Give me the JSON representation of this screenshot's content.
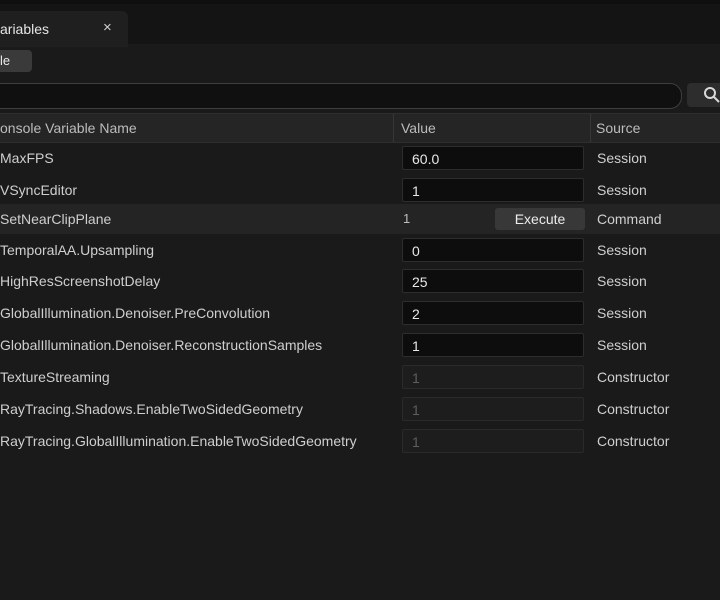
{
  "tab": {
    "title": "ariables",
    "close_label": "×"
  },
  "toolbar": {
    "button_label": "le"
  },
  "search": {
    "placeholder": "",
    "value": ""
  },
  "columns": {
    "name": "onsole Variable Name",
    "value": "Value",
    "source": "Source"
  },
  "rows": [
    {
      "name": "MaxFPS",
      "value": "60.0",
      "source": "Session",
      "kind": "edit"
    },
    {
      "name": "VSyncEditor",
      "value": "1",
      "source": "Session",
      "kind": "edit"
    },
    {
      "name": "SetNearClipPlane",
      "value": "1",
      "source": "Command",
      "kind": "command",
      "button": "Execute"
    },
    {
      "name": "TemporalAA.Upsampling",
      "value": "0",
      "source": "Session",
      "kind": "edit"
    },
    {
      "name": "HighResScreenshotDelay",
      "value": "25",
      "source": "Session",
      "kind": "edit"
    },
    {
      "name": "GlobalIllumination.Denoiser.PreConvolution",
      "value": "2",
      "source": "Session",
      "kind": "edit"
    },
    {
      "name": "GlobalIllumination.Denoiser.ReconstructionSamples",
      "value": "1",
      "source": "Session",
      "kind": "edit"
    },
    {
      "name": "TextureStreaming",
      "value": "1",
      "source": "Constructor",
      "kind": "readonly"
    },
    {
      "name": "RayTracing.Shadows.EnableTwoSidedGeometry",
      "value": "1",
      "source": "Constructor",
      "kind": "readonly"
    },
    {
      "name": "RayTracing.GlobalIllumination.EnableTwoSidedGeometry",
      "value": "1",
      "source": "Constructor",
      "kind": "readonly"
    }
  ],
  "icons": {
    "search_button": "search-settings-icon"
  },
  "colors": {
    "background": "#1a1a1a",
    "input_bg": "#0d0d0d",
    "button_bg": "#383838"
  }
}
